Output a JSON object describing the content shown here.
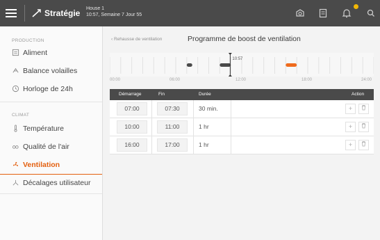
{
  "topbar": {
    "section_title": "Stratégie",
    "house_name": "House 1",
    "house_info": "10:57, Semaine 7 Jour 55",
    "icons": [
      "menu-icon",
      "strategy-icon",
      "camera-icon",
      "report-icon",
      "bell-icon",
      "search-icon"
    ],
    "badge_color": "#f2b705"
  },
  "sidebar": {
    "sections": [
      {
        "title": "PRODUCTION",
        "items": [
          {
            "label": "Aliment",
            "icon": "feed-icon"
          },
          {
            "label": "Balance volailles",
            "icon": "bird-scale-icon"
          },
          {
            "label": "Horloge de 24h",
            "icon": "clock-icon"
          }
        ]
      },
      {
        "title": "CLIMAT",
        "items": [
          {
            "label": "Température",
            "icon": "thermometer-icon"
          },
          {
            "label": "Qualité de l'air",
            "icon": "co2-icon"
          },
          {
            "label": "Ventilation",
            "icon": "fan-icon",
            "active": true
          },
          {
            "label": "Décalages utilisateur",
            "icon": "user-offset-icon"
          }
        ]
      }
    ],
    "accent_color": "#e35f0e"
  },
  "main": {
    "back_link": "Rehausse de ventilation",
    "title": "Programme de boost de ventilation",
    "timeline": {
      "now_label": "10:57",
      "now_hour": 10.95,
      "ticks": [
        "00:00",
        "06:00",
        "12:00",
        "18:00",
        "24:00"
      ],
      "periods": [
        {
          "start": 7.0,
          "end": 7.5
        },
        {
          "start": 10.0,
          "end": 11.0
        },
        {
          "start": 16.0,
          "end": 17.0
        }
      ],
      "period_color": "#4a4a4a",
      "highlight_color": "#ef6b1d"
    },
    "table": {
      "headers": {
        "start": "Démarrage",
        "end": "Fin",
        "duration": "Durée",
        "action": "Action"
      },
      "rows": [
        {
          "start": "07:00",
          "end": "07:30",
          "duration": "30 min."
        },
        {
          "start": "10:00",
          "end": "11:00",
          "duration": "1 hr"
        },
        {
          "start": "16:00",
          "end": "17:00",
          "duration": "1 hr"
        }
      ],
      "add_symbol": "+"
    }
  }
}
